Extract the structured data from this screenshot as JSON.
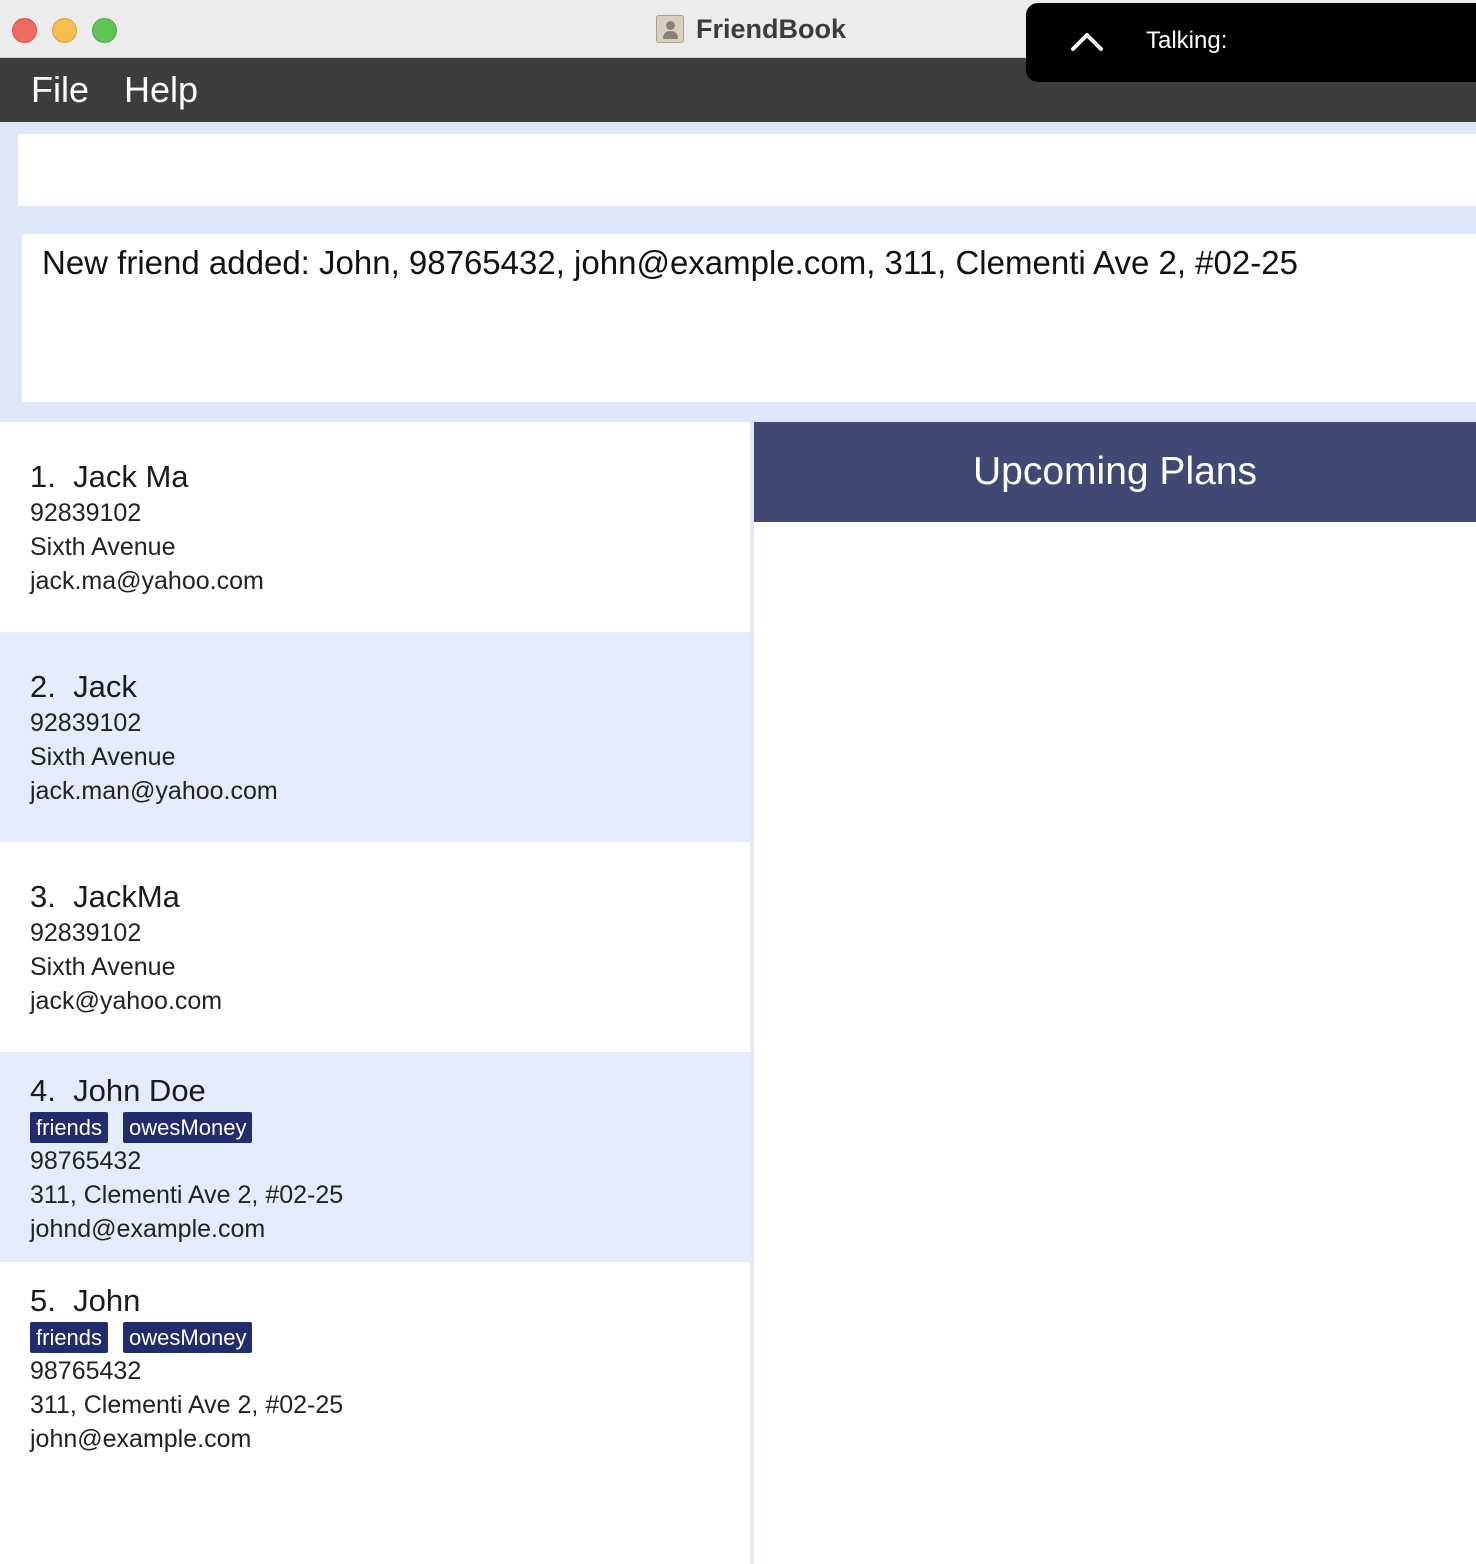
{
  "window": {
    "title": "FriendBook"
  },
  "overlay": {
    "talking_label": "Talking:"
  },
  "menu": {
    "items": [
      "File",
      "Help"
    ]
  },
  "command": {
    "value": "",
    "placeholder": ""
  },
  "result": {
    "text": "New friend added: John, 98765432, john@example.com, 311, Clementi Ave 2, #02-25"
  },
  "persons": [
    {
      "index": "1.",
      "name": "Jack Ma",
      "tags": [],
      "phone": "92839102",
      "address": "Sixth Avenue",
      "email": "jack.ma@yahoo.com"
    },
    {
      "index": "2.",
      "name": "Jack",
      "tags": [],
      "phone": "92839102",
      "address": "Sixth Avenue",
      "email": "jack.man@yahoo.com"
    },
    {
      "index": "3.",
      "name": "JackMa",
      "tags": [],
      "phone": "92839102",
      "address": "Sixth Avenue",
      "email": "jack@yahoo.com"
    },
    {
      "index": "4.",
      "name": "John Doe",
      "tags": [
        "friends",
        "owesMoney"
      ],
      "phone": "98765432",
      "address": "311, Clementi Ave 2, #02-25",
      "email": "johnd@example.com"
    },
    {
      "index": "5.",
      "name": "John",
      "tags": [
        "friends",
        "owesMoney"
      ],
      "phone": "98765432",
      "address": "311, Clementi Ave 2, #02-25",
      "email": "john@example.com"
    }
  ],
  "plans": {
    "title": "Upcoming Plans"
  },
  "colors": {
    "menubar": "#3d3d3d",
    "tag_bg": "#232c6b",
    "plans_header": "#3f4973",
    "alt_row": "#e4ebfb",
    "background": "#dde7f7"
  }
}
